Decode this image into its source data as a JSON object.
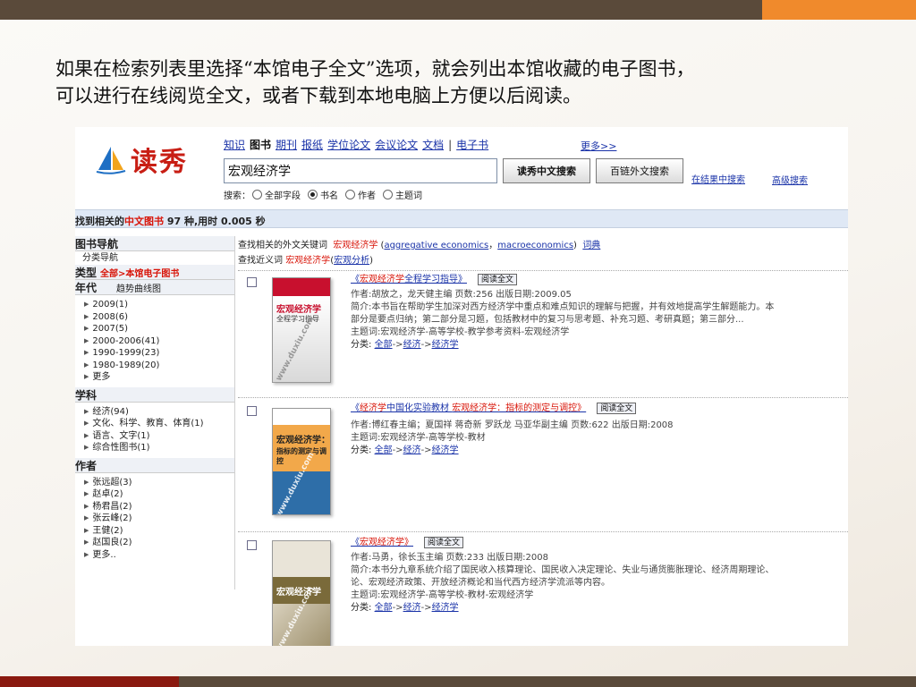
{
  "slide": {
    "caption_line1": "如果在检索列表里选择“本馆电子全文”选项，就会列出本馆收藏的电子图书，",
    "caption_line2": "可以进行在线阅览全文，或者下载到本地电脑上方便以后阅读。",
    "colors": {
      "top_bar": "#5a4a3a",
      "accent": "#f08a2c",
      "bottom_accent": "#8a1a10"
    }
  },
  "app": {
    "logo_text": "读秀",
    "nav": [
      "知识",
      "图书",
      "期刊",
      "报纸",
      "学位论文",
      "会议论文",
      "文档"
    ],
    "nav_active": "图书",
    "nav_sep": "|",
    "nav_ebook": "电子书",
    "more": "更多>>",
    "search_value": "宏观经济学",
    "btn_cn_search": "读秀中文搜索",
    "btn_foreign_search": "百链外文搜索",
    "search_within": "在结果中搜索",
    "advanced_search": "高级搜索",
    "search_by_label": "搜索：",
    "search_options": [
      {
        "label": "全部字段",
        "checked": false
      },
      {
        "label": "书名",
        "checked": true
      },
      {
        "label": "作者",
        "checked": false
      },
      {
        "label": "主题词",
        "checked": false
      }
    ]
  },
  "result_bar": {
    "prefix": "找到相关的",
    "scope": "中文图书",
    "count": " 97 种,用时 ",
    "time": "0.005 秒"
  },
  "sidebar": {
    "nav_title": "图书导航",
    "nav_sub": "分类导航",
    "type_title": "类型",
    "type_value": "全部>本馆电子图书",
    "year_title": "年代",
    "year_trend": "趋势曲线图",
    "years": [
      "2009(1)",
      "2008(6)",
      "2007(5)",
      "2000-2006(41)",
      "1990-1999(23)",
      "1980-1989(20)",
      "更多"
    ],
    "subject_title": "学科",
    "subjects": [
      "经济(94)",
      "文化、科学、教育、体育(1)",
      "语言、文字(1)",
      "综合性图书(1)"
    ],
    "author_title": "作者",
    "authors": [
      "张远超(3)",
      "赵卓(2)",
      "杨君昌(2)",
      "张云峰(2)",
      "王健(2)",
      "赵国良(2)",
      "更多.."
    ]
  },
  "main": {
    "foreign_kw_label": "查找相关的外文关键词",
    "foreign_kw_term": "宏观经济学",
    "foreign_kw_open": " (",
    "foreign_kw_1": "aggregative economics",
    "foreign_kw_comma": "，",
    "foreign_kw_2": "macroeconomics",
    "foreign_kw_close": ")",
    "dict_link": "词典",
    "near_label": "查找近义词",
    "near_term": "宏观经济学",
    "near_open": "(",
    "near_link": "宏观分析",
    "near_close": ")",
    "read_label": "阅读全文",
    "results": [
      {
        "title_open": "《",
        "title_red": "宏观经济学",
        "title_rest": "全程学习指导》",
        "author": "作者:胡放之，龙天健主编  页数:256  出版日期:2009.05",
        "summary1": "简介:本书旨在帮助学生加深对西方经济学中重点和难点知识的理解与把握，并有效地提高学生解题能力。本",
        "summary2": "部分是要点归纳；第二部分是习题，包括教材中的复习与思考题、补充习题、考研真题；第三部分...",
        "subject": "主题词:宏观经济学-高等学校-教学参考资料-宏观经济学",
        "class_label": "分类:",
        "class_path": [
          "全部",
          "经济",
          "经济学"
        ],
        "cover_title": "宏观经济学",
        "cover_sub": "全程学习指导"
      },
      {
        "title_open": "《",
        "title_red": "经济学",
        "title_mid": "中国化实验教材  ",
        "title_red2": "宏观经济学：指标的测定与调控》",
        "author": "作者:博红春主编；夏国祥  蒋奇新  罗跃龙  马亚华副主编  页数:622  出版日期:2008",
        "subject": "主题词:宏观经济学-高等学校-教材",
        "class_label": "分类:",
        "class_path": [
          "全部",
          "经济",
          "经济学"
        ],
        "cover_title": "宏观经济学：",
        "cover_sub": "指标的测定与调控"
      },
      {
        "title_open": "《",
        "title_red": "宏观经济学》",
        "author": "作者:马勇，徐长玉主编  页数:233  出版日期:2008",
        "summary1": "简介:本书分九章系统介绍了国民收入核算理论、国民收入决定理论、失业与通货膨胀理论、经济周期理论、",
        "summary2": "论、宏观经济政策、开放经济概论和当代西方经济学流派等内容。",
        "subject": "主题词:宏观经济学-高等学校-教材-宏观经济学",
        "class_label": "分类:",
        "class_path": [
          "全部",
          "经济",
          "经济学"
        ],
        "cover_title": "宏观经济学"
      }
    ],
    "watermark": "www.duxiu.com",
    "arrow": "->"
  }
}
